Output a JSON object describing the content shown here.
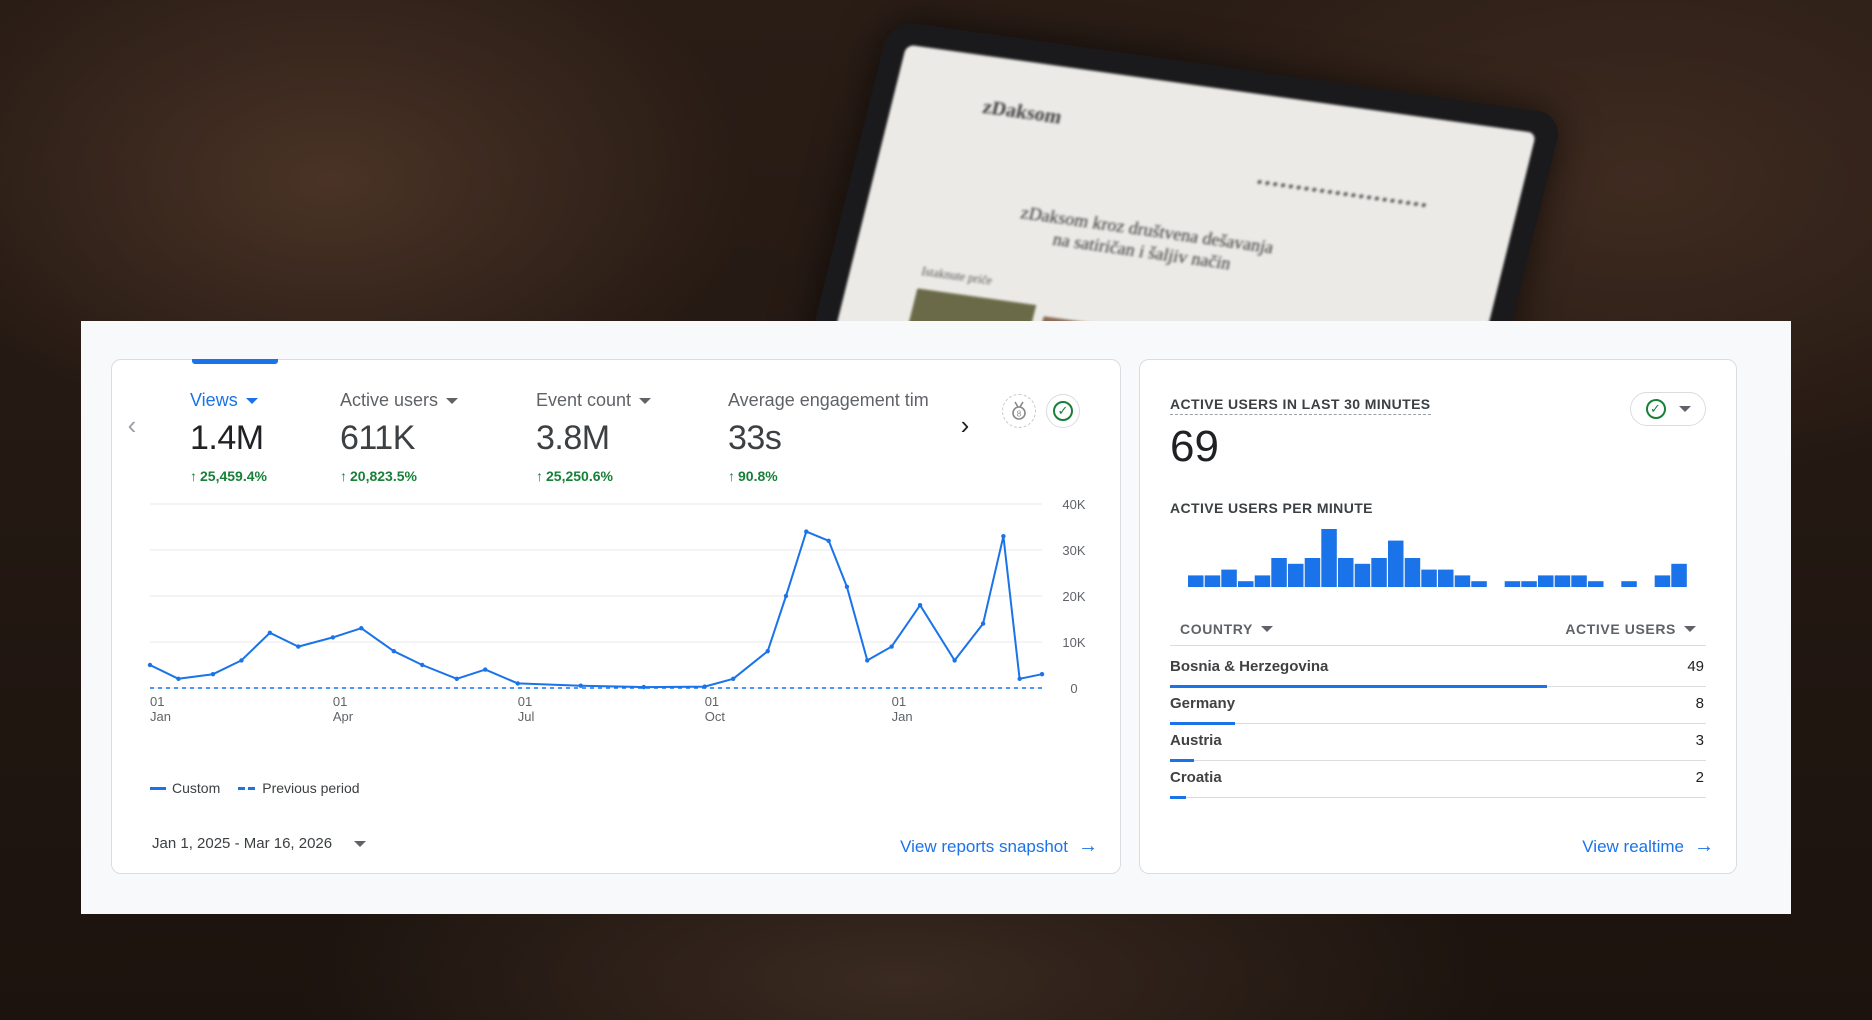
{
  "background": {
    "laptop_site_logo": "zDaksom",
    "laptop_headline": "zDaksom kroz društvena dešavanja na satiričan i šaljiv način",
    "laptop_subheading": "Istaknute priče"
  },
  "overview": {
    "metrics": [
      {
        "label": "Views",
        "value": "1.4M",
        "change": "25,459.4%",
        "active": true
      },
      {
        "label": "Active users",
        "value": "611K",
        "change": "20,823.5%",
        "active": false
      },
      {
        "label": "Event count",
        "value": "3.8M",
        "change": "25,250.6%",
        "active": false
      },
      {
        "label": "Average engagement tim",
        "value": "33s",
        "change": "90.8%",
        "active": false
      }
    ],
    "icons": {
      "prev": "chevron-left-icon",
      "next": "chevron-right-icon",
      "insights": "insights-badge-icon",
      "status": "check-circle-icon"
    },
    "legend": {
      "current": "Custom",
      "previous": "Previous period"
    },
    "date_range": "Jan 1, 2025 - Mar 16, 2026",
    "view_link": "View reports snapshot"
  },
  "chart_data": [
    {
      "type": "line",
      "x_ticks": [
        {
          "top": "01",
          "bottom": "Jan"
        },
        {
          "top": "01",
          "bottom": "Apr"
        },
        {
          "top": "01",
          "bottom": "Jul"
        },
        {
          "top": "01",
          "bottom": "Oct"
        },
        {
          "top": "01",
          "bottom": "Jan"
        }
      ],
      "y_ticks": [
        "40K",
        "30K",
        "20K",
        "10K",
        "0"
      ],
      "ylim": [
        0,
        40000
      ],
      "x": [
        "2025-01-01",
        "2025-01-15",
        "2025-02-01",
        "2025-02-15",
        "2025-03-01",
        "2025-03-15",
        "2025-04-01",
        "2025-04-15",
        "2025-05-01",
        "2025-05-15",
        "2025-06-01",
        "2025-06-15",
        "2025-07-01",
        "2025-08-01",
        "2025-09-01",
        "2025-10-01",
        "2025-10-15",
        "2025-11-01",
        "2025-11-10",
        "2025-11-20",
        "2025-12-01",
        "2025-12-10",
        "2025-12-20",
        "2026-01-01",
        "2026-01-15",
        "2026-02-01",
        "2026-02-15",
        "2026-02-25",
        "2026-03-05",
        "2026-03-16"
      ],
      "series": [
        {
          "name": "Custom",
          "style": "solid",
          "values": [
            5000,
            2000,
            3000,
            6000,
            12000,
            9000,
            11000,
            13000,
            8000,
            5000,
            2000,
            4000,
            1000,
            500,
            200,
            300,
            2000,
            8000,
            20000,
            34000,
            32000,
            22000,
            6000,
            9000,
            18000,
            6000,
            14000,
            33000,
            2000,
            3000
          ]
        },
        {
          "name": "Previous period",
          "style": "dashed",
          "values": [
            0,
            0,
            0,
            0,
            0,
            0,
            0,
            0,
            0,
            0,
            0,
            0,
            0,
            0,
            0,
            0,
            0,
            0,
            0,
            0,
            0,
            0,
            0,
            0,
            0,
            0,
            0,
            0,
            0,
            0
          ]
        }
      ]
    },
    {
      "type": "bar",
      "title": "ACTIVE USERS PER MINUTE",
      "values": [
        2,
        2,
        3,
        1,
        2,
        5,
        4,
        5,
        10,
        5,
        4,
        5,
        8,
        5,
        3,
        3,
        2,
        1,
        0,
        1,
        1,
        2,
        2,
        2,
        1,
        0,
        1,
        0,
        2,
        4
      ]
    }
  ],
  "realtime": {
    "title": "ACTIVE USERS IN LAST 30 MINUTES",
    "count": "69",
    "subtitle": "ACTIVE USERS PER MINUTE",
    "col_country": "COUNTRY",
    "col_users": "ACTIVE USERS",
    "rows": [
      {
        "country": "Bosnia & Herzegovina",
        "users": "49",
        "share": 0.7
      },
      {
        "country": "Germany",
        "users": "8",
        "share": 0.12
      },
      {
        "country": "Austria",
        "users": "3",
        "share": 0.045
      },
      {
        "country": "Croatia",
        "users": "2",
        "share": 0.03
      }
    ],
    "view_link": "View realtime"
  },
  "colors": {
    "accent": "#1a73e8",
    "positive": "#188038",
    "text": "#202124"
  }
}
